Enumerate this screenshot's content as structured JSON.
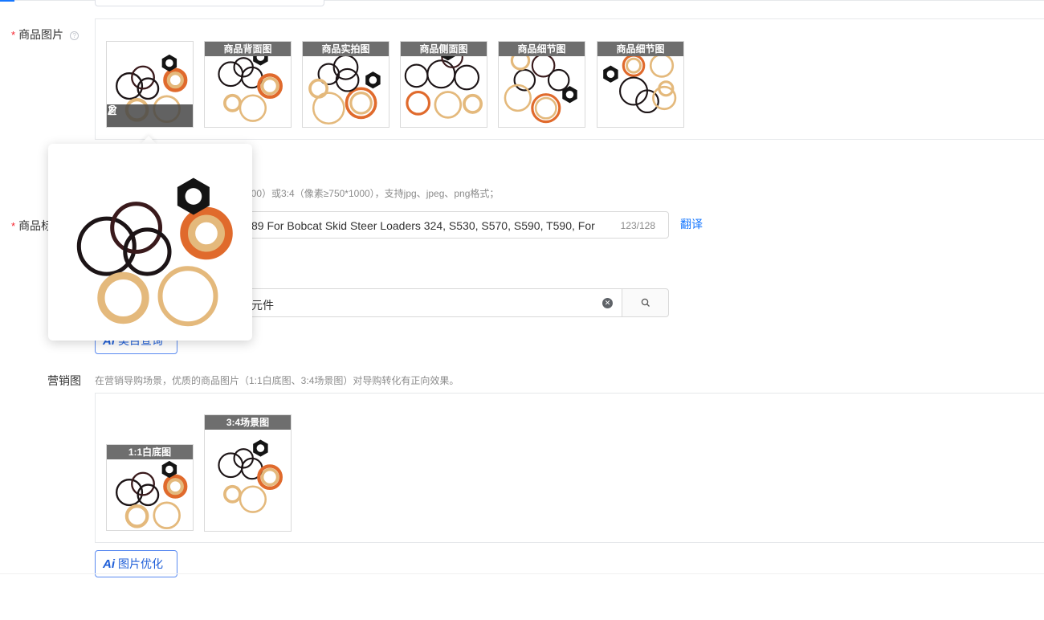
{
  "product_images": {
    "label": "商品图片",
    "required_mark": "*",
    "help_icon": "question-circle-icon",
    "main_toolbar": {
      "edit_icon": "edit-pencil-icon",
      "delete_icon": "trash-icon",
      "next_icon": "chevron-right-icon"
    },
    "thumbnails": [
      {
        "caption": ""
      },
      {
        "caption": "商品背面图"
      },
      {
        "caption": "商品实拍图"
      },
      {
        "caption": "商品侧面图"
      },
      {
        "caption": "商品细节图"
      },
      {
        "caption": "商品细节图"
      }
    ],
    "hint": "800）或3:4（像素≥750*1000），支持jpg、jpeg、png格式；"
  },
  "product_title": {
    "label_visible": "商品标",
    "required_mark": "*",
    "value": "89 For Bobcat Skid Steer Loaders 324, S530, S570, S590, T590, For",
    "char_count": "123/128",
    "translate_label": "翻译"
  },
  "category": {
    "value": "元件",
    "clear_icon": "clear-circle-icon",
    "search_icon": "search-icon",
    "ai_button_label": "类目查询"
  },
  "marketing": {
    "label": "营销图",
    "hint": "在营销导购场景，优质的商品图片（1:1白底图、3:4场景图）对导购转化有正向效果。",
    "thumbnails": [
      {
        "caption": "1:1白底图"
      },
      {
        "caption": "3:4场景图"
      }
    ],
    "ai_button_label": "图片优化",
    "ai_icon": "ai-sparkle-icon"
  },
  "colors": {
    "primary": "#1677ff",
    "required": "#f5222d",
    "ring_black": "#1c1416",
    "ring_brown": "#3a1a1c",
    "ring_orange": "#e06a2c",
    "ring_tan": "#e4b97c",
    "nut": "#141414"
  }
}
